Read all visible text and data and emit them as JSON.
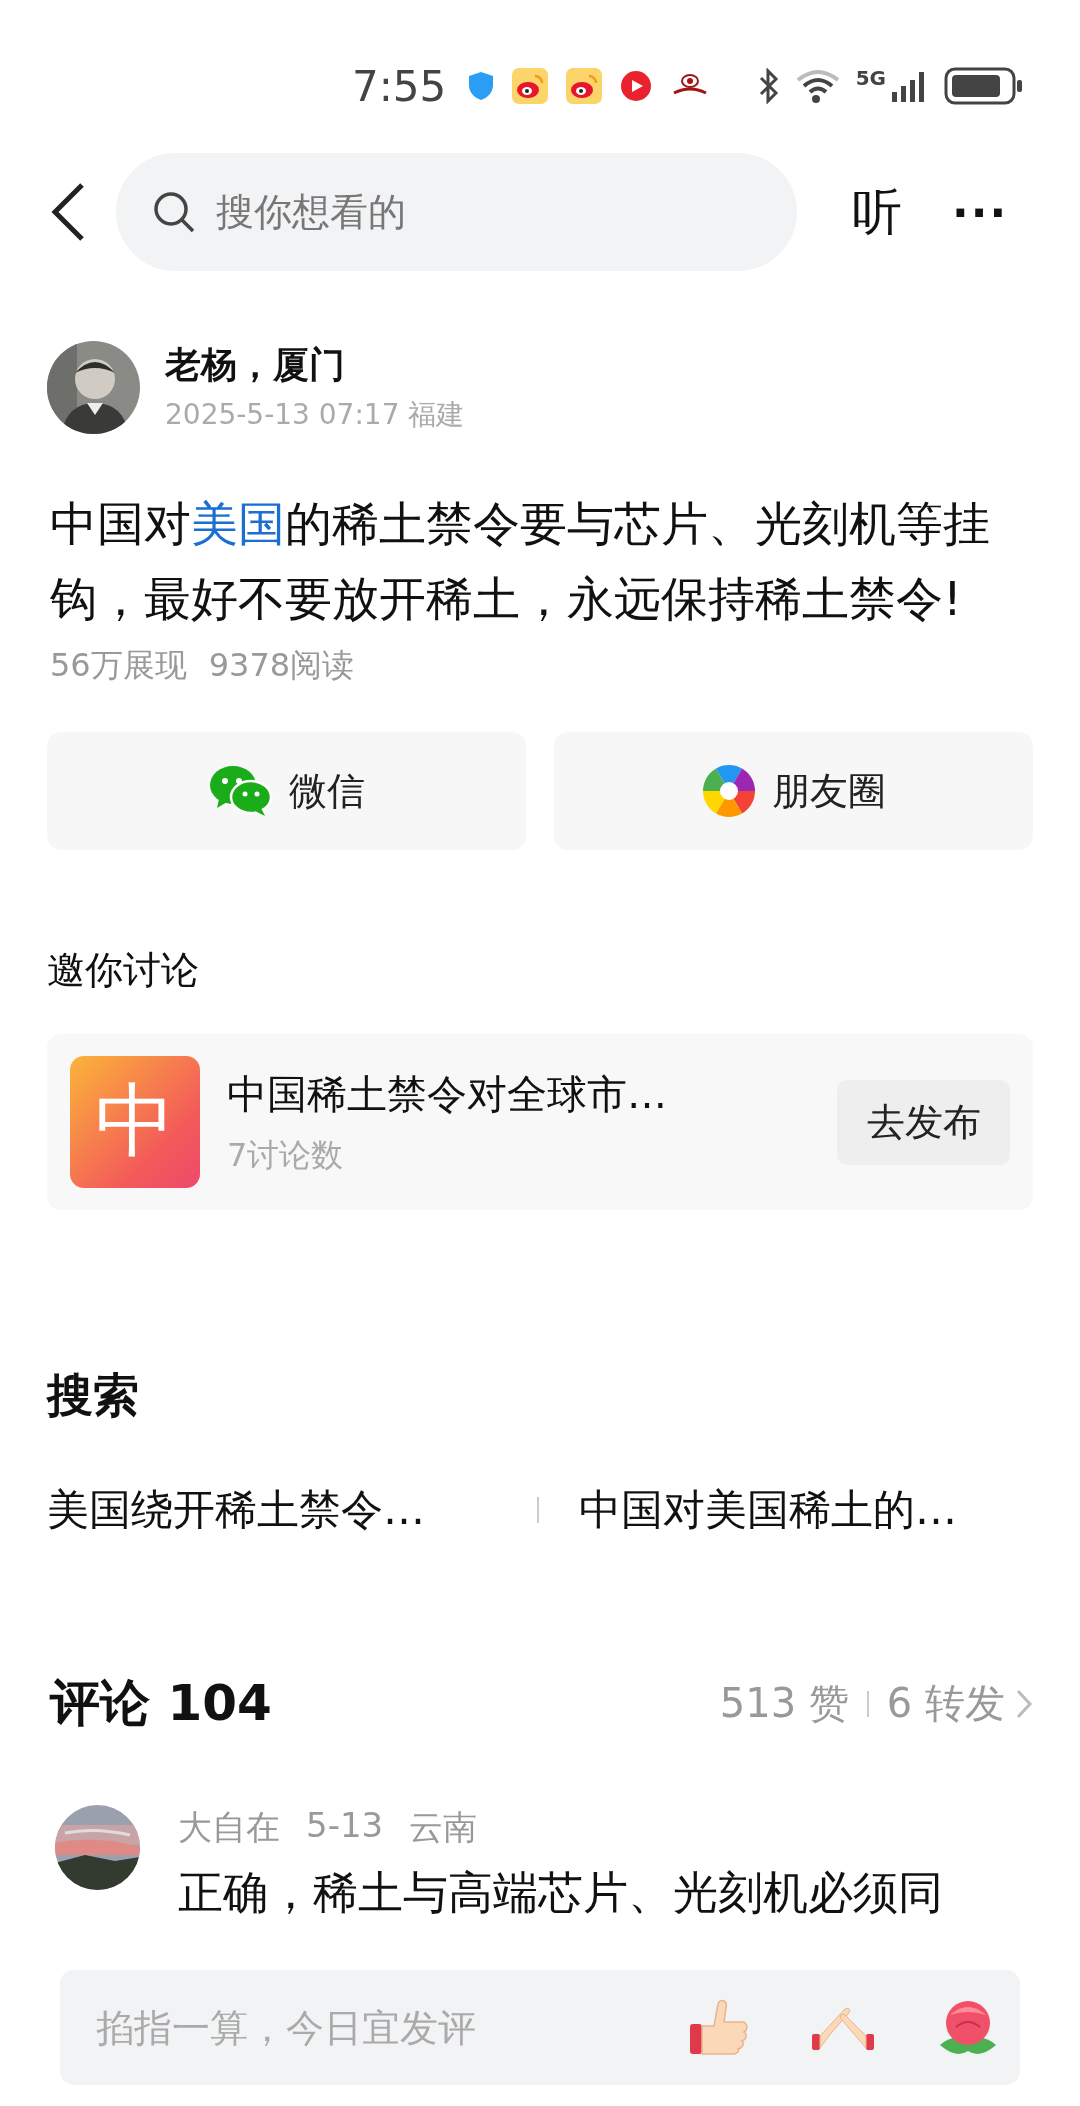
{
  "status_bar": {
    "time": "7:55",
    "network_label": "5G"
  },
  "header": {
    "search": {
      "placeholder": "搜你想看的"
    },
    "listen_label": "听",
    "more_label": "···"
  },
  "post": {
    "author": "老杨，厦门",
    "meta": "2025-5-13 07:17 福建",
    "text_parts": [
      {
        "kind": "plain",
        "text": "中国对"
      },
      {
        "kind": "link",
        "text": "美国"
      },
      {
        "kind": "plain",
        "text": "的稀土禁令要与芯片、光刻机等挂钩，最好不要放开稀土，永远保持稀土禁令!"
      }
    ],
    "stats": [
      "56万展现",
      "9378阅读"
    ]
  },
  "share": [
    {
      "kind": "wechat",
      "label": "微信"
    },
    {
      "kind": "moments",
      "label": "朋友圈"
    }
  ],
  "discussion": {
    "heading": "邀你讨论",
    "badge": "中",
    "title": "中国稀土禁令对全球市…",
    "count": "7讨论数",
    "button": "去发布"
  },
  "search_section": {
    "heading": "搜索",
    "items": [
      "美国绕开稀土禁令…",
      "中国对美国稀土的…"
    ]
  },
  "comments": {
    "heading": "评论 104",
    "likes": "513 赞",
    "reposts": "6 转发",
    "items": [
      {
        "user": "大自在",
        "date": "5-13",
        "location": "云南",
        "text": "正确，稀土与高端芯片、光刻机必须同"
      }
    ]
  },
  "comment_bar": {
    "placeholder": "掐指一算，今日宜发评",
    "reactions": [
      {
        "kind": "thumbs_up"
      },
      {
        "kind": "hands"
      },
      {
        "kind": "flower"
      }
    ]
  }
}
